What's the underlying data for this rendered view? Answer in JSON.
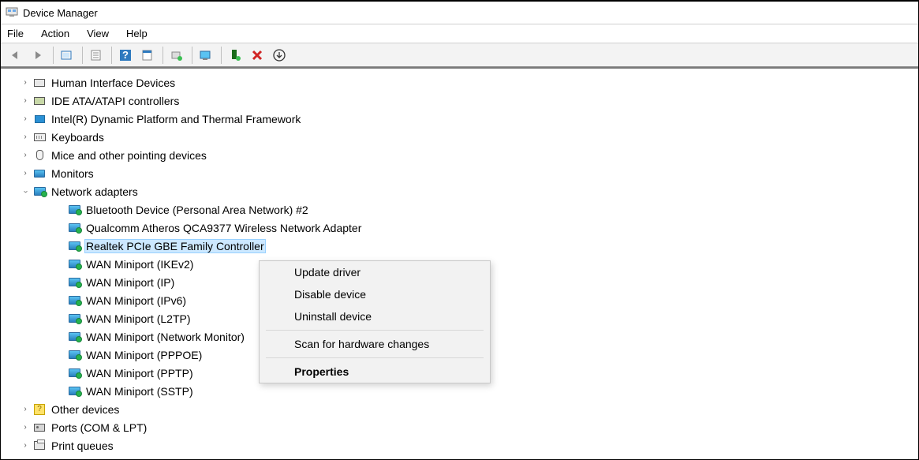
{
  "window": {
    "title": "Device Manager"
  },
  "menu": {
    "file": "File",
    "action": "Action",
    "view": "View",
    "help": "Help"
  },
  "toolbar_icons": {
    "back": "back-arrow-icon",
    "fwd": "forward-arrow-icon",
    "show_hidden": "show-hidden-icon",
    "properties": "properties-sheet-icon",
    "help": "help-icon",
    "action_props": "properties-icon",
    "update": "update-driver-icon",
    "scan": "scan-hardware-icon",
    "add_legacy": "add-legacy-icon",
    "remove": "remove-device-icon",
    "uninstall": "uninstall-icon"
  },
  "tree": [
    {
      "label": "Human Interface Devices",
      "icon": "hid-icon",
      "expanded": false,
      "level": 0
    },
    {
      "label": "IDE ATA/ATAPI controllers",
      "icon": "ide-icon",
      "expanded": false,
      "level": 0
    },
    {
      "label": "Intel(R) Dynamic Platform and Thermal Framework",
      "icon": "chip-icon",
      "expanded": false,
      "level": 0
    },
    {
      "label": "Keyboards",
      "icon": "keyboard-icon",
      "expanded": false,
      "level": 0
    },
    {
      "label": "Mice and other pointing devices",
      "icon": "mouse-icon",
      "expanded": false,
      "level": 0
    },
    {
      "label": "Monitors",
      "icon": "monitor-icon",
      "expanded": false,
      "level": 0
    },
    {
      "label": "Network adapters",
      "icon": "network-adapter-icon",
      "expanded": true,
      "level": 0,
      "children": [
        {
          "label": "Bluetooth Device (Personal Area Network) #2",
          "icon": "nic-icon"
        },
        {
          "label": "Qualcomm Atheros QCA9377 Wireless Network Adapter",
          "icon": "nic-icon"
        },
        {
          "label": "Realtek PCIe GBE Family Controller",
          "icon": "nic-icon",
          "selected": true
        },
        {
          "label": "WAN Miniport (IKEv2)",
          "icon": "nic-icon"
        },
        {
          "label": "WAN Miniport (IP)",
          "icon": "nic-icon"
        },
        {
          "label": "WAN Miniport (IPv6)",
          "icon": "nic-icon"
        },
        {
          "label": "WAN Miniport (L2TP)",
          "icon": "nic-icon"
        },
        {
          "label": "WAN Miniport (Network Monitor)",
          "icon": "nic-icon"
        },
        {
          "label": "WAN Miniport (PPPOE)",
          "icon": "nic-icon"
        },
        {
          "label": "WAN Miniport (PPTP)",
          "icon": "nic-icon"
        },
        {
          "label": "WAN Miniport (SSTP)",
          "icon": "nic-icon"
        }
      ]
    },
    {
      "label": "Other devices",
      "icon": "other-icon",
      "expanded": false,
      "level": 0
    },
    {
      "label": "Ports (COM & LPT)",
      "icon": "port-icon",
      "expanded": false,
      "level": 0
    },
    {
      "label": "Print queues",
      "icon": "printer-icon",
      "expanded": false,
      "level": 0
    }
  ],
  "context_menu": {
    "update": "Update driver",
    "disable": "Disable device",
    "uninstall": "Uninstall device",
    "scan": "Scan for hardware changes",
    "properties": "Properties"
  }
}
